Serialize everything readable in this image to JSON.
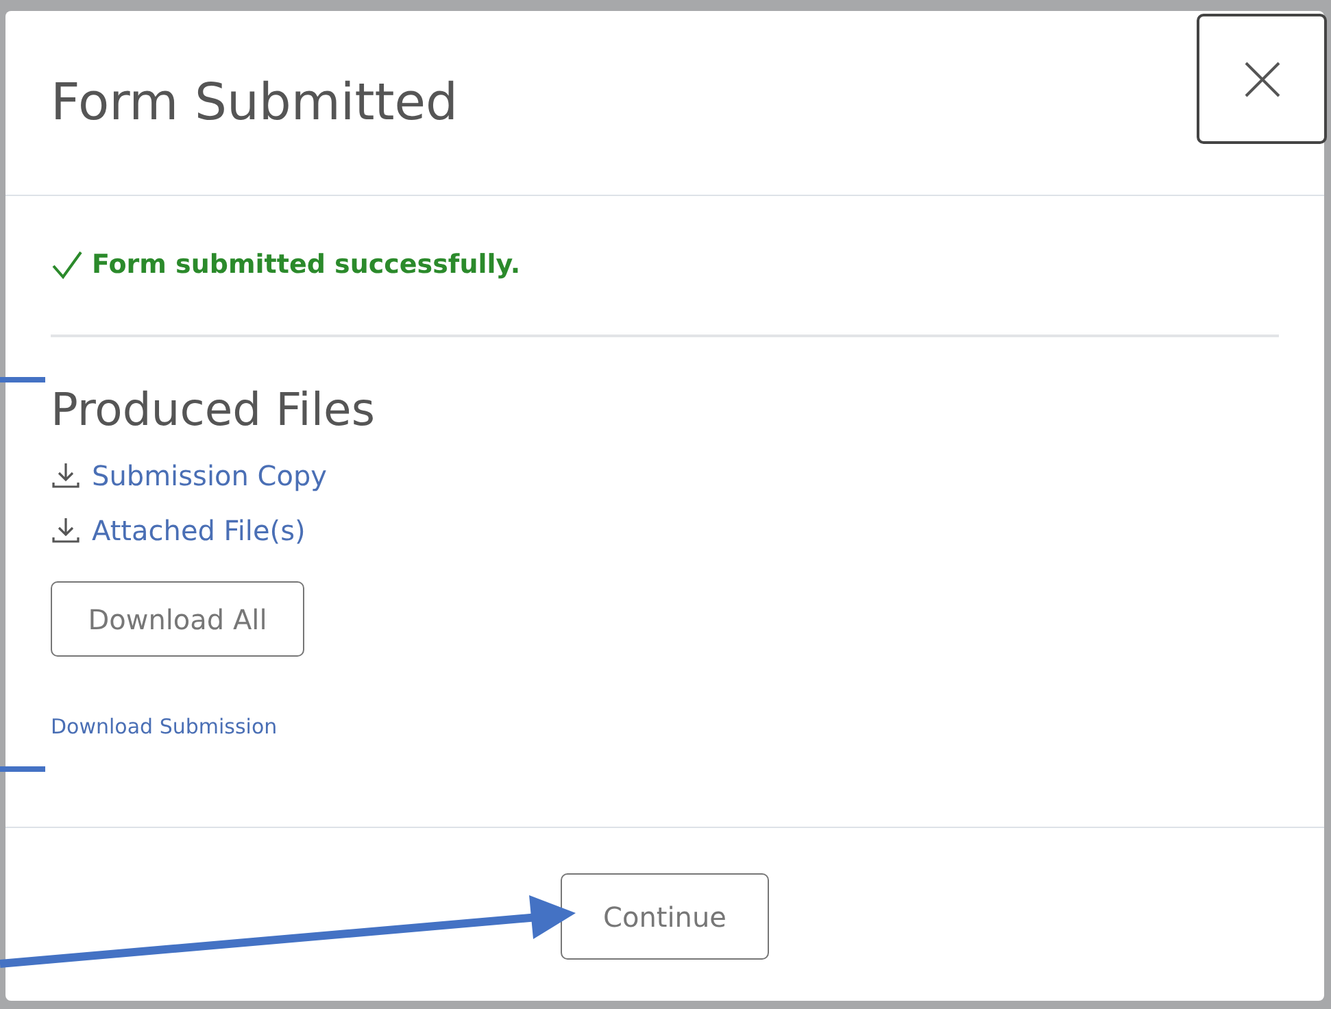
{
  "dialog": {
    "title": "Form Submitted"
  },
  "status": {
    "message": "Form submitted successfully."
  },
  "produced_files": {
    "heading": "Produced Files",
    "files": [
      {
        "label": "Submission Copy"
      },
      {
        "label": "Attached File(s)"
      }
    ],
    "download_all": "Download All"
  },
  "download_submission": "Download Submission",
  "footer": {
    "continue": "Continue"
  }
}
